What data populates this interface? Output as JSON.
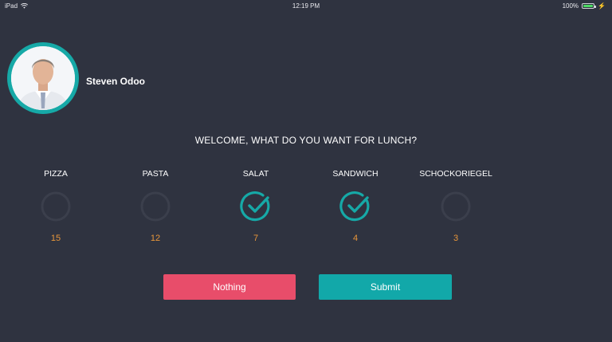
{
  "status_bar": {
    "device": "iPad",
    "time": "12:19 PM",
    "battery": "100%"
  },
  "user": {
    "name": "Steven Odoo"
  },
  "question": "WELCOME, WHAT DO YOU WANT FOR LUNCH?",
  "options": [
    {
      "label": "PIZZA",
      "count": "15",
      "selected": false
    },
    {
      "label": "PASTA",
      "count": "12",
      "selected": false
    },
    {
      "label": "SALAT",
      "count": "7",
      "selected": true
    },
    {
      "label": "SANDWICH",
      "count": "4",
      "selected": true
    },
    {
      "label": "SCHOCKORIEGEL",
      "count": "3",
      "selected": false
    }
  ],
  "buttons": {
    "nothing": "Nothing",
    "submit": "Submit"
  },
  "colors": {
    "background": "#2f3340",
    "accent": "#16a9a7",
    "count": "#e8963a",
    "nothing_button": "#e84d6a",
    "submit_button": "#12a8a9",
    "unselected_ring": "#3b3f4c"
  }
}
